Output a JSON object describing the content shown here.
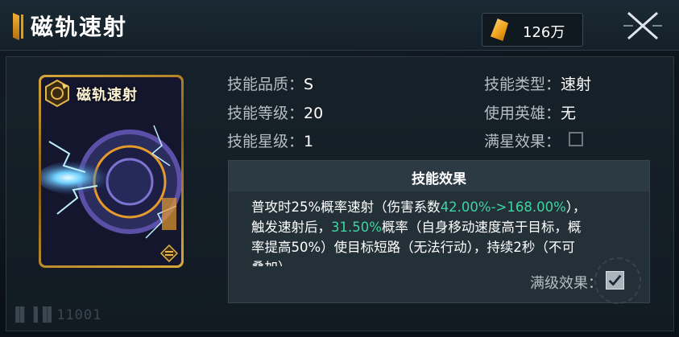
{
  "header": {
    "title": "磁轨速射",
    "currency": {
      "amount": "126万",
      "icon": "gold-crystal-icon"
    },
    "close_icon": "close-icon"
  },
  "card": {
    "title": "磁轨速射",
    "badge_icon": "skill-type-badge-icon",
    "corner_icon": "rank-chevron-icon"
  },
  "details": {
    "quality_label": "技能品质：",
    "quality_value": "S",
    "level_label": "技能等级：",
    "level_value": "20",
    "star_label": "技能星级：",
    "star_value": "1",
    "type_label": "技能类型：",
    "type_value": "速射",
    "hero_label": "使用英雄：",
    "hero_value": "无",
    "full_star_label": "满星效果：",
    "full_star_checked": false
  },
  "effect": {
    "heading": "技能效果",
    "line1_a": "普攻时25%概率速射（伤害系数",
    "line1_hl": "42.00%->168.00%",
    "line1_b": "），",
    "line2_a": "触发速射后，",
    "line2_hl": "31.50%",
    "line2_b": "概率（自身移动速度高于目标，概",
    "line3": "率提高50%）使目标短路（无法行动），持续2秒（不可",
    "line4": "叠加）",
    "max_level_label": "满级效果：",
    "max_level_checked": true
  },
  "footer": {
    "id_text": "11001"
  },
  "colors": {
    "highlight": "#3ed4a0",
    "gold": "#d7a73a",
    "panel": "#162129"
  }
}
